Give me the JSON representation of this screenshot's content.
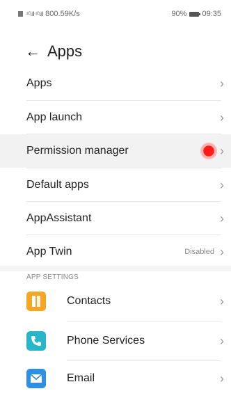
{
  "status_bar": {
    "network": "⁴ᴳ.ıll ⁴ᴳ.ıll",
    "speed": "800.59K/s",
    "battery": "90%",
    "time": "09:35"
  },
  "header": {
    "back": "←",
    "title": "Apps"
  },
  "menu": [
    {
      "label": "Apps",
      "status": ""
    },
    {
      "label": "App launch",
      "status": ""
    },
    {
      "label": "Permission manager",
      "status": ""
    },
    {
      "label": "Default apps",
      "status": ""
    },
    {
      "label": "AppAssistant",
      "status": ""
    },
    {
      "label": "App Twin",
      "status": "Disabled"
    }
  ],
  "chevron": "›",
  "section": {
    "title": "APP SETTINGS"
  },
  "apps": [
    {
      "label": "Contacts",
      "icon": "contacts-icon",
      "color": "#f5a623"
    },
    {
      "label": "Phone Services",
      "icon": "phone-icon",
      "color": "#29b6c8"
    },
    {
      "label": "Email",
      "icon": "email-icon",
      "color": "#2f8fe0"
    }
  ],
  "colors": {
    "record_dot": "#ff1a1a",
    "highlight": "#f2f2f2"
  }
}
